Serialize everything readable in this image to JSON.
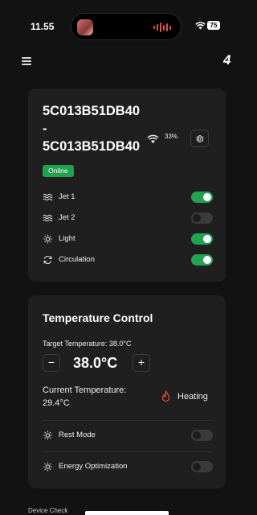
{
  "status_bar": {
    "time": "11.55",
    "battery": "75"
  },
  "device": {
    "id_text": "5C013B51DB40\n-\n5C013B51DB40",
    "signal_percent": "33%",
    "status": "Online",
    "controls": [
      {
        "label": "Jet 1",
        "icon": "waves-icon",
        "on": true
      },
      {
        "label": "Jet 2",
        "icon": "waves-icon",
        "on": false
      },
      {
        "label": "Light",
        "icon": "sun-icon",
        "on": true
      },
      {
        "label": "Circulation",
        "icon": "refresh-icon",
        "on": true
      }
    ]
  },
  "temperature": {
    "title": "Temperature Control",
    "target_label": "Target Temperature: 38.0°C",
    "decrease": "−",
    "increase": "+",
    "target_value": "38.0°C",
    "current_label": "Current Temperature: 29.4°C",
    "heating_label": "Heating",
    "modes": [
      {
        "label": "Rest Mode",
        "icon": "sun-icon",
        "on": false
      },
      {
        "label": "Energy Optimization",
        "icon": "sun-icon",
        "on": false
      }
    ]
  },
  "footer": {
    "partial_text": "Device Check"
  },
  "colors": {
    "accent_green": "#21a353",
    "badge_green": "#1fa14e",
    "heating_red": "#e8453c",
    "card_bg": "#1f1f1f"
  }
}
